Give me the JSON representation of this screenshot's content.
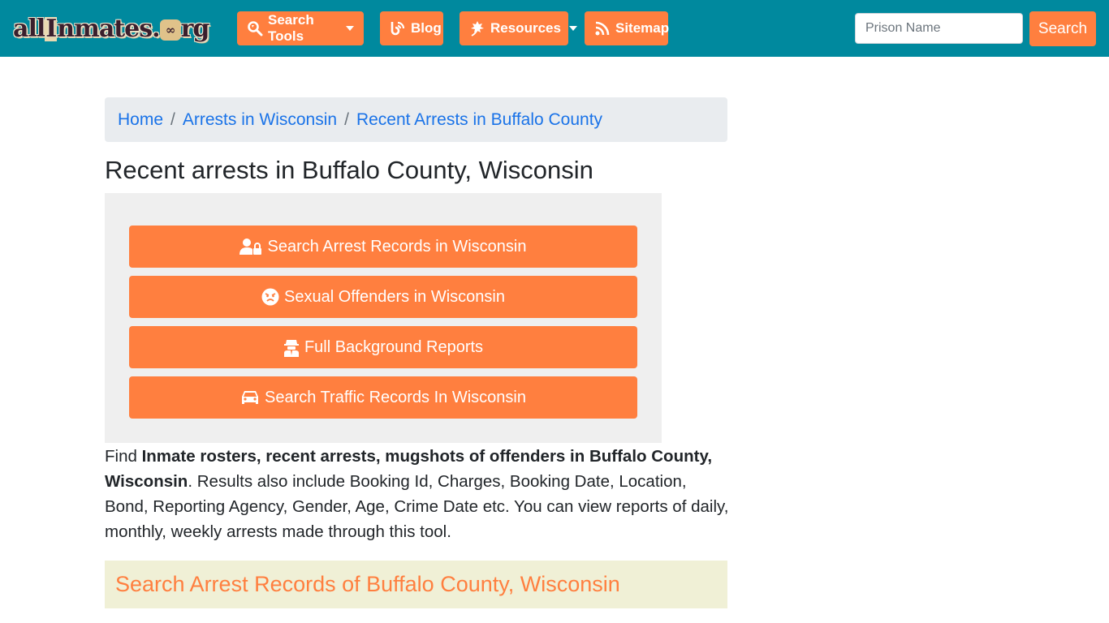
{
  "header": {
    "logo_text": "allInmates.org",
    "logo_parts": {
      "a": "a",
      "ll": "ll",
      "i": "I",
      "nmates": "nmates",
      "dot": ".",
      "o": "o",
      "rg": "rg"
    },
    "nav": [
      {
        "label": "Search Tools",
        "icon": "search-icon",
        "has_dropdown": true
      },
      {
        "label": "Blog",
        "icon": "blog-icon",
        "has_dropdown": false
      },
      {
        "label": "Resources",
        "icon": "leaf-icon",
        "has_dropdown": true
      },
      {
        "label": "Sitemap",
        "icon": "rss-icon",
        "has_dropdown": false
      }
    ],
    "search": {
      "placeholder": "Prison Name",
      "value": "",
      "button_label": "Search"
    }
  },
  "breadcrumb": [
    {
      "label": "Home"
    },
    {
      "label": "Arrests in Wisconsin"
    },
    {
      "label": "Recent Arrests in Buffalo County"
    }
  ],
  "breadcrumb_separator": "/",
  "page_title": "Recent arrests in Buffalo County, Wisconsin",
  "actions": [
    {
      "label": "Search Arrest Records in Wisconsin",
      "icon": "user-lock-icon"
    },
    {
      "label": "Sexual Offenders in Wisconsin",
      "icon": "angry-face-icon"
    },
    {
      "label": "Full Background Reports",
      "icon": "user-secret-icon"
    },
    {
      "label": "Search Traffic Records In Wisconsin",
      "icon": "car-icon"
    }
  ],
  "description": {
    "prefix": "Find ",
    "bold": "Inmate rosters, recent arrests, mugshots of offenders in Buffalo County, Wisconsin",
    "suffix": ". Results also include Booking Id, Charges, Booking Date, Location, Bond, Reporting Agency, Gender, Age, Crime Date etc. You can view reports of daily, monthly, weekly arrests made through this tool."
  },
  "section_heading": "Search Arrest Records of Buffalo County, Wisconsin",
  "colors": {
    "navbar": "#00899e",
    "accent": "#ff7f3f",
    "link": "#1a73e8",
    "breadcrumb_bg": "#e9ecef",
    "panel_bg": "#efefef",
    "section_bg": "#f0f0d6"
  }
}
